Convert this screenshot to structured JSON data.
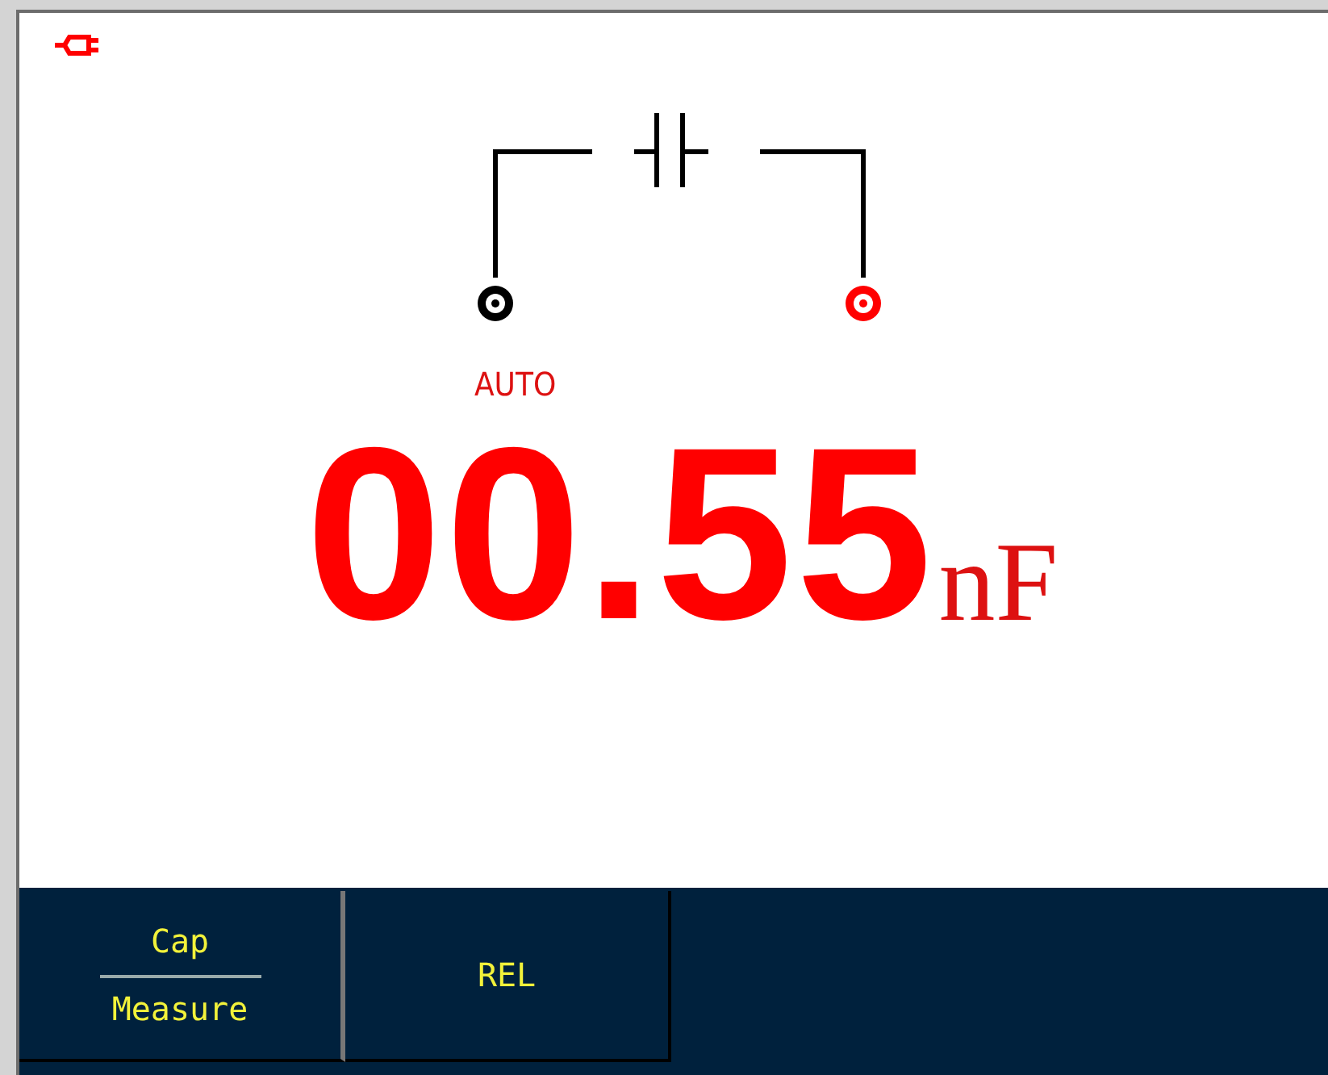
{
  "reading": {
    "range": "AUTO",
    "value": "00.55",
    "unit": "nF"
  },
  "softkeys": [
    {
      "kind": "split",
      "lines": [
        "Cap",
        "Measure"
      ]
    },
    {
      "kind": "single",
      "label": "REL"
    }
  ]
}
